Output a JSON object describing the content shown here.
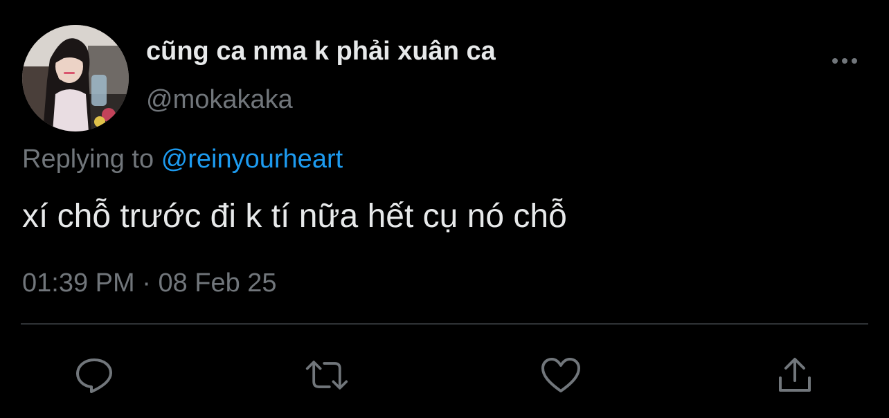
{
  "colors": {
    "background": "#000000",
    "primary_text": "#e7e9ea",
    "secondary_text": "#71767b",
    "link": "#1d9bf0",
    "divider": "#2f3336"
  },
  "author": {
    "display_name": "cũng ca nma k phải xuân ca",
    "handle": "@mokakaka",
    "avatar_icon": "profile-photo-avatar"
  },
  "reply": {
    "prefix": "Replying to",
    "mention": "@reinyourheart"
  },
  "tweet": {
    "text": "xí chỗ trước đi k tí nữa hết cụ nó chỗ",
    "time": "01:39 PM",
    "separator": "·",
    "date": "08 Feb 25"
  },
  "actions": [
    {
      "icon": "reply-icon"
    },
    {
      "icon": "retweet-icon"
    },
    {
      "icon": "like-icon"
    },
    {
      "icon": "share-icon"
    }
  ],
  "more_menu_icon": "more-horizontal-icon"
}
